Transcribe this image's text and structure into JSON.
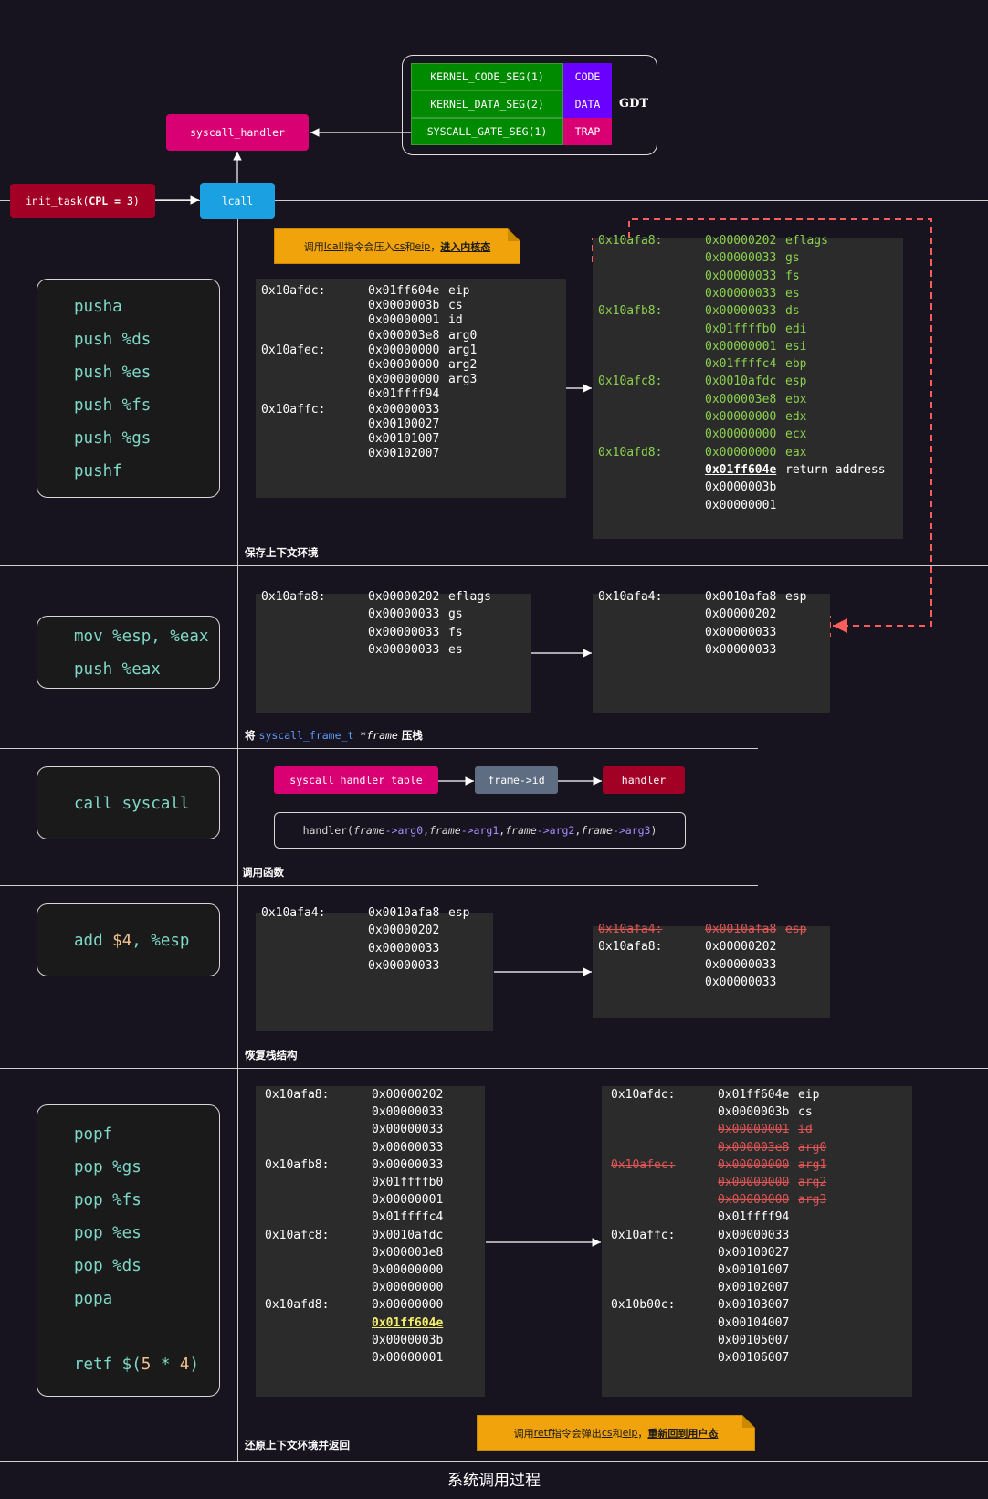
{
  "title": "系统调用过程",
  "gdt": {
    "label": "GDT",
    "rows": [
      {
        "name": "KERNEL_CODE_SEG(1)",
        "type": "CODE"
      },
      {
        "name": "KERNEL_DATA_SEG(2)",
        "type": "DATA"
      },
      {
        "name": "SYSCALL_GATE_SEG(1)",
        "type": "TRAP"
      }
    ]
  },
  "top": {
    "syscall_handler": "syscall_handler",
    "init_task_prefix": "init_task(",
    "init_task_cpl": "CPL = 3",
    "init_task_suffix": ")",
    "lcall": "lcall"
  },
  "note1": {
    "t1": "调用 ",
    "t2": "lcall",
    "t3": " 指令会压入 ",
    "t4": "cs",
    "t5": " 和 ",
    "t6": "eip",
    "t7": "，",
    "t8": "进入内核态"
  },
  "note2": {
    "t1": "调用 ",
    "t2": "retf",
    "t3": " 指令会弹出 ",
    "t4": "cs",
    "t5": " 和 ",
    "t6": "eip",
    "t7": "，",
    "t8": "重新回到用户态"
  },
  "sections": {
    "s1": {
      "caption": "保存上下文环境",
      "code": [
        "pusha",
        "push %ds",
        "push %es",
        "push %fs",
        "push %gs",
        "pushf"
      ],
      "left_rows": [
        {
          "addr": "0x10afdc:",
          "val": "0x01ff604e",
          "lbl": "eip"
        },
        {
          "addr": "",
          "val": "0x0000003b",
          "lbl": "cs"
        },
        {
          "addr": "",
          "val": "0x00000001",
          "lbl": "id"
        },
        {
          "addr": "",
          "val": "0x000003e8",
          "lbl": "arg0"
        },
        {
          "addr": "0x10afec:",
          "val": "0x00000000",
          "lbl": "arg1"
        },
        {
          "addr": "",
          "val": "0x00000000",
          "lbl": "arg2"
        },
        {
          "addr": "",
          "val": "0x00000000",
          "lbl": "arg3"
        },
        {
          "addr": "",
          "val": "0x01ffff94",
          "lbl": ""
        },
        {
          "addr": "0x10affc:",
          "val": "0x00000033",
          "lbl": ""
        },
        {
          "addr": "",
          "val": "0x00100027",
          "lbl": ""
        },
        {
          "addr": "",
          "val": "0x00101007",
          "lbl": ""
        },
        {
          "addr": "",
          "val": "0x00102007",
          "lbl": ""
        }
      ],
      "right_rows": [
        {
          "addr": "0x10afa8:",
          "val": "0x00000202",
          "lbl": "eflags"
        },
        {
          "addr": "",
          "val": "0x00000033",
          "lbl": "gs"
        },
        {
          "addr": "",
          "val": "0x00000033",
          "lbl": "fs"
        },
        {
          "addr": "",
          "val": "0x00000033",
          "lbl": "es"
        },
        {
          "addr": "0x10afb8:",
          "val": "0x00000033",
          "lbl": "ds"
        },
        {
          "addr": "",
          "val": "0x01ffffb0",
          "lbl": "edi"
        },
        {
          "addr": "",
          "val": "0x00000001",
          "lbl": "esi"
        },
        {
          "addr": "",
          "val": "0x01ffffc4",
          "lbl": "ebp"
        },
        {
          "addr": "0x10afc8:",
          "val": "0x0010afdc",
          "lbl": "esp"
        },
        {
          "addr": "",
          "val": "0x000003e8",
          "lbl": "ebx"
        },
        {
          "addr": "",
          "val": "0x00000000",
          "lbl": "edx"
        },
        {
          "addr": "",
          "val": "0x00000000",
          "lbl": "ecx"
        },
        {
          "addr": "0x10afd8:",
          "val": "0x00000000",
          "lbl": "eax"
        },
        {
          "addr": "",
          "val": "0x01ff604e",
          "lbl": "return address"
        },
        {
          "addr": "",
          "val": "0x0000003b",
          "lbl": ""
        },
        {
          "addr": "",
          "val": "0x00000001",
          "lbl": ""
        }
      ]
    },
    "s2": {
      "caption_pre": "将 ",
      "caption_type": "syscall_frame_t",
      "caption_var": " *frame",
      "caption_post": " 压栈",
      "code": [
        "mov %esp, %eax",
        "push %eax"
      ],
      "left_rows": [
        {
          "addr": "0x10afa8:",
          "val": "0x00000202",
          "lbl": "eflags"
        },
        {
          "addr": "",
          "val": "0x00000033",
          "lbl": "gs"
        },
        {
          "addr": "",
          "val": "0x00000033",
          "lbl": "fs"
        },
        {
          "addr": "",
          "val": "0x00000033",
          "lbl": "es"
        }
      ],
      "right_rows": [
        {
          "addr": "0x10afa4:",
          "val": "0x0010afa8",
          "lbl": "esp"
        },
        {
          "addr": "",
          "val": "0x00000202",
          "lbl": ""
        },
        {
          "addr": "",
          "val": "0x00000033",
          "lbl": ""
        },
        {
          "addr": "",
          "val": "0x00000033",
          "lbl": ""
        }
      ]
    },
    "s3": {
      "caption": "调用函数",
      "code": [
        "call syscall"
      ],
      "table": "syscall_handler_table",
      "frame_id": "frame->id",
      "handler": "handler",
      "call": {
        "p0": "handler(",
        "f1": "frame",
        "a1": "->arg0",
        "c1": ", ",
        "f2": "frame",
        "a2": "->arg1",
        "c2": ", ",
        "f3": "frame",
        "a3": "->arg2",
        "c3": ", ",
        "f4": "frame",
        "a4": "->arg3",
        "p1": ")"
      }
    },
    "s4": {
      "caption": "恢复栈结构",
      "code_op": "add ",
      "code_num": "$4",
      "code_rest": ", %esp",
      "left_rows": [
        {
          "addr": "0x10afa4:",
          "val": "0x0010afa8",
          "lbl": "esp"
        },
        {
          "addr": "",
          "val": "0x00000202",
          "lbl": ""
        },
        {
          "addr": "",
          "val": "0x00000033",
          "lbl": ""
        },
        {
          "addr": "",
          "val": "0x00000033",
          "lbl": ""
        }
      ],
      "right_rows": [
        {
          "addr": "0x10afa4:",
          "val": "0x0010afa8",
          "lbl": "esp"
        },
        {
          "addr": "0x10afa8:",
          "val": "0x00000202",
          "lbl": ""
        },
        {
          "addr": "",
          "val": "0x00000033",
          "lbl": ""
        },
        {
          "addr": "",
          "val": "0x00000033",
          "lbl": ""
        }
      ]
    },
    "s5": {
      "caption": "还原上下文环境并返回",
      "code": [
        "popf",
        "pop %gs",
        "pop %fs",
        "pop %es",
        "pop %ds",
        "popa"
      ],
      "retf_op": "retf $(",
      "retf_a": "5",
      "retf_mid": " * ",
      "retf_b": "4",
      "retf_end": ")",
      "left_rows": [
        {
          "addr": "0x10afa8:",
          "val": "0x00000202"
        },
        {
          "addr": "",
          "val": "0x00000033"
        },
        {
          "addr": "",
          "val": "0x00000033"
        },
        {
          "addr": "",
          "val": "0x00000033"
        },
        {
          "addr": "0x10afb8:",
          "val": "0x00000033"
        },
        {
          "addr": "",
          "val": "0x01ffffb0"
        },
        {
          "addr": "",
          "val": "0x00000001"
        },
        {
          "addr": "",
          "val": "0x01ffffc4"
        },
        {
          "addr": "0x10afc8:",
          "val": "0x0010afdc"
        },
        {
          "addr": "",
          "val": "0x000003e8"
        },
        {
          "addr": "",
          "val": "0x00000000"
        },
        {
          "addr": "",
          "val": "0x00000000"
        },
        {
          "addr": "0x10afd8:",
          "val": "0x00000000"
        },
        {
          "addr": "",
          "val": "0x01ff604e"
        },
        {
          "addr": "",
          "val": "0x0000003b"
        },
        {
          "addr": "",
          "val": "0x00000001"
        }
      ],
      "right_rows": [
        {
          "addr": "0x10afdc:",
          "val": "0x01ff604e",
          "lbl": "eip"
        },
        {
          "addr": "",
          "val": "0x0000003b",
          "lbl": "cs"
        },
        {
          "addr": "",
          "val": "0x00000001",
          "lbl": "id"
        },
        {
          "addr": "",
          "val": "0x000003e8",
          "lbl": "arg0"
        },
        {
          "addr": "0x10afec:",
          "val": "0x00000000",
          "lbl": "arg1"
        },
        {
          "addr": "",
          "val": "0x00000000",
          "lbl": "arg2"
        },
        {
          "addr": "",
          "val": "0x00000000",
          "lbl": "arg3"
        },
        {
          "addr": "",
          "val": "0x01ffff94",
          "lbl": ""
        },
        {
          "addr": "0x10affc:",
          "val": "0x00000033",
          "lbl": ""
        },
        {
          "addr": "",
          "val": "0x00100027",
          "lbl": ""
        },
        {
          "addr": "",
          "val": "0x00101007",
          "lbl": ""
        },
        {
          "addr": "",
          "val": "0x00102007",
          "lbl": ""
        },
        {
          "addr": "0x10b00c:",
          "val": "0x00103007",
          "lbl": ""
        },
        {
          "addr": "",
          "val": "0x00104007",
          "lbl": ""
        },
        {
          "addr": "",
          "val": "0x00105007",
          "lbl": ""
        },
        {
          "addr": "",
          "val": "0x00106007",
          "lbl": ""
        }
      ]
    }
  }
}
